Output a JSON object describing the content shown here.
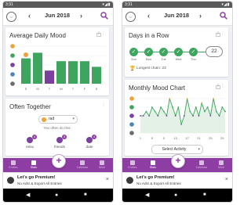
{
  "status_bar": {
    "time": "3:31",
    "icons": "▾◢▮"
  },
  "app_bar": {
    "logo": "daylio",
    "month": "Jun 2018",
    "prev": "‹",
    "next": "›"
  },
  "average_daily_mood": {
    "title": "Average Daily Mood",
    "day_labels": [
      "S",
      "M",
      "T",
      "W",
      "T",
      "F",
      "S"
    ],
    "mood_levels": [
      "rad",
      "good",
      "meh",
      "bad",
      "awful"
    ],
    "bar_values": [
      3.7,
      4.3,
      2.4,
      3.4,
      3.4,
      3.4,
      2.8
    ],
    "bar_colors": [
      "#3da55d",
      "#3da55d",
      "#7b3fa0",
      "#3da55d",
      "#3da55d",
      "#3da55d",
      "#3da55d"
    ],
    "scale_colors": [
      "#f0a23a",
      "#3da55d",
      "#7b3fa0",
      "#4a84b8",
      "#6b6b6b"
    ]
  },
  "often_together": {
    "title": "Often Together",
    "selected_mood": "rad",
    "subtitle": "You often do this:",
    "activities": [
      {
        "label": "relax",
        "count": "4"
      },
      {
        "label": "friends",
        "count": "3"
      },
      {
        "label": "date",
        "count": "4"
      }
    ]
  },
  "days_in_a_row": {
    "title": "Days in a Row",
    "days": [
      "Sun",
      "Mon",
      "Tue",
      "Wed",
      "Thu"
    ],
    "current_streak": "22",
    "longest_chain": "Longest chain: 22"
  },
  "monthly_mood_chart": {
    "title": "Monthly Mood Chart",
    "x_labels": [
      "1",
      "5",
      "9",
      "13",
      "17",
      "21",
      "25",
      "29"
    ],
    "select_label": "Select Activity",
    "mood_levels": [
      "rad",
      "good",
      "meh",
      "bad",
      "awful"
    ],
    "scale_colors": [
      "#f0a23a",
      "#3da55d",
      "#7b3fa0",
      "#4a84b8",
      "#6b6b6b"
    ]
  },
  "chart_data": {
    "type": "line",
    "x": [
      1,
      2,
      3,
      4,
      5,
      6,
      7,
      8,
      9,
      10,
      11,
      12,
      13,
      14,
      15,
      16,
      17,
      18,
      19,
      20,
      21,
      22,
      23,
      24,
      25,
      26,
      27,
      28,
      29,
      30
    ],
    "values": [
      3,
      3,
      3.5,
      3,
      4,
      3.5,
      3,
      4,
      3.5,
      3,
      5,
      4,
      3,
      4,
      2,
      3,
      5,
      3.5,
      3,
      4,
      3,
      4.5,
      3.5,
      4,
      3,
      5,
      3.5,
      3,
      4,
      3.5
    ],
    "ylim": [
      1,
      5
    ]
  },
  "bottom_nav": {
    "items": [
      "Entries",
      "Stats",
      "",
      "Calendar",
      "More"
    ],
    "fab": "+"
  },
  "promo": {
    "title": "Let's go Premium!",
    "subtitle": "No Ads! & Export All Entries",
    "close": "×"
  },
  "system_nav": {
    "back": "◀",
    "home": "●",
    "recents": "■"
  }
}
